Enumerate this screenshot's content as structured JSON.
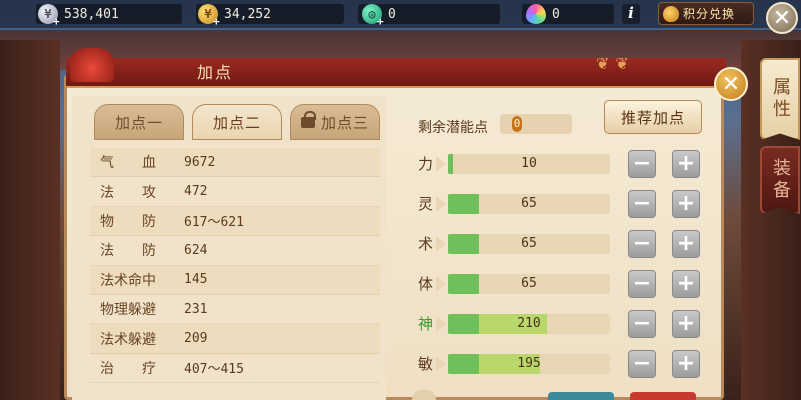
{
  "currencies": [
    {
      "icon": "silver-coin-icon",
      "value": "538,401"
    },
    {
      "icon": "gold-coin-icon",
      "value": "34,252"
    },
    {
      "icon": "jade-coin-icon",
      "value": "0"
    },
    {
      "icon": "gem-icon",
      "value": "0"
    }
  ],
  "topbar": {
    "info_glyph": "i",
    "exchange_label": "积分兑换"
  },
  "side_tabs": {
    "attributes": "属性",
    "equipment": "装备"
  },
  "panel": {
    "title": "加点",
    "close_glyph": "✕"
  },
  "tabs": [
    {
      "label": "加点一",
      "active": false
    },
    {
      "label": "加点二",
      "active": true
    },
    {
      "label": "加点三",
      "active": false,
      "locked": true
    }
  ],
  "stats": [
    {
      "label": "气　　血",
      "value": "9672"
    },
    {
      "label": "法　　攻",
      "value": "472"
    },
    {
      "label": "物　　防",
      "value": "617～621"
    },
    {
      "label": "法　　防",
      "value": "624"
    },
    {
      "label": "法术命中",
      "value": "145"
    },
    {
      "label": "物理躲避",
      "value": "231"
    },
    {
      "label": "法术躲避",
      "value": "209"
    },
    {
      "label": "治　　疗",
      "value": "407～415"
    }
  ],
  "points": {
    "remaining_label": "剩余潜能点",
    "remaining_value": "0",
    "recommend_label": "推荐加点"
  },
  "attributes": [
    {
      "name": "力",
      "value": "10",
      "fill": 0.03,
      "extra": 0,
      "highlight": false
    },
    {
      "name": "灵",
      "value": "65",
      "fill": 0.19,
      "extra": 0,
      "highlight": false
    },
    {
      "name": "术",
      "value": "65",
      "fill": 0.19,
      "extra": 0,
      "highlight": false
    },
    {
      "name": "体",
      "value": "65",
      "fill": 0.19,
      "extra": 0,
      "highlight": false
    },
    {
      "name": "神",
      "value": "210",
      "fill": 0.19,
      "extra": 0.42,
      "highlight": true
    },
    {
      "name": "敏",
      "value": "195",
      "fill": 0.19,
      "extra": 0.38,
      "highlight": false
    }
  ],
  "controls": {
    "minus_glyph": "−",
    "plus_glyph": "+"
  },
  "colors": {
    "bar_fill": "#6fc05a",
    "bar_extra": "#b8d86c",
    "header_red": "#9b2a20",
    "highlight_green": "#3a9a2a"
  }
}
